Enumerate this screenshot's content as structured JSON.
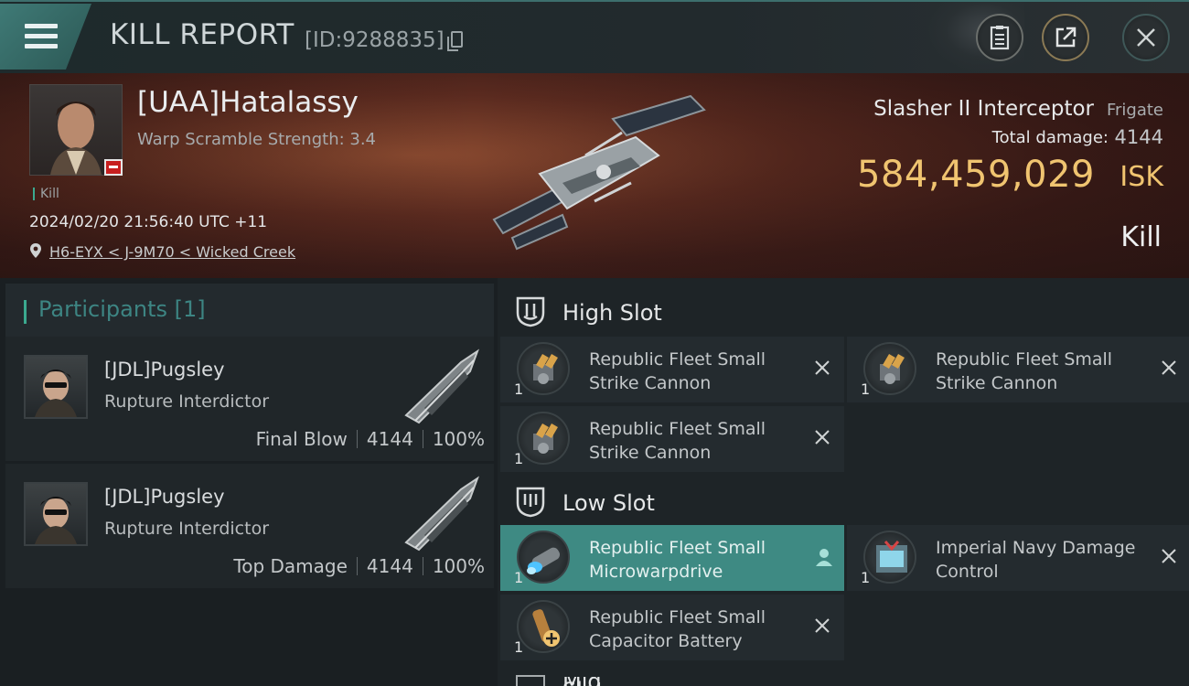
{
  "window": {
    "title": "KILL REPORT",
    "report_id": "[ID:9288835]"
  },
  "victim": {
    "name": "[UAA]Hatalassy",
    "warp_scramble": "Warp Scramble Strength: 3.4",
    "kill_tag": "Kill",
    "datetime": "2024/02/20 21:56:40 UTC +11",
    "location": "H6-EYX < J-9M70 < Wicked Creek",
    "ship_name": "Slasher II Interceptor",
    "ship_class": "Frigate",
    "total_damage_label": "Total damage:",
    "total_damage": "4144",
    "isk_value": "584,459,029",
    "isk_unit": "ISK",
    "result": "Kill"
  },
  "participants": {
    "title": "Participants [1]",
    "rows": [
      {
        "name": "[JDL]Pugsley",
        "ship": "Rupture Interdictor",
        "role": "Final Blow",
        "damage": "4144",
        "percent": "100%"
      },
      {
        "name": "[JDL]Pugsley",
        "ship": "Rupture Interdictor",
        "role": "Top Damage",
        "damage": "4144",
        "percent": "100%"
      }
    ]
  },
  "fitting": {
    "high_slot": {
      "title": "High Slot",
      "items": [
        {
          "name": "Republic Fleet Small Strike Cannon",
          "qty": "1"
        },
        {
          "name": "Republic Fleet Small Strike Cannon",
          "qty": "1"
        },
        {
          "name": "Republic Fleet Small Strike Cannon",
          "qty": "1"
        }
      ]
    },
    "low_slot": {
      "title": "Low Slot",
      "items": [
        {
          "name": "Republic Fleet Small Microwarpdrive",
          "qty": "1"
        },
        {
          "name": "Imperial Navy Damage Control",
          "qty": "1"
        },
        {
          "name": "Republic Fleet Small Capacitor Battery",
          "qty": "1"
        }
      ]
    },
    "next_section_peek": "Mid Slot"
  },
  "colors": {
    "accent_teal": "#3e8a83",
    "isk_gold": "#f0c470",
    "alert_red": "#c71f1f"
  },
  "icons": [
    "menu-icon",
    "clipboard-icon",
    "export-icon",
    "close-icon",
    "copy-icon",
    "location-pin-icon",
    "slot-shield-icon",
    "destroyed-x-icon",
    "person-icon"
  ]
}
